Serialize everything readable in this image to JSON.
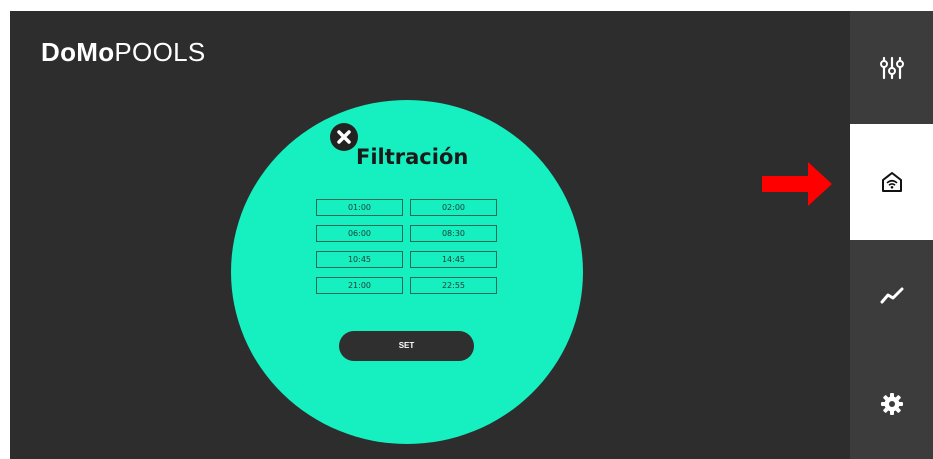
{
  "app": {
    "logo_bold": "DoMo",
    "logo_regular": "POOLS"
  },
  "dialog": {
    "title": "Filtración",
    "schedule": [
      {
        "start": "01:00",
        "end": "02:00"
      },
      {
        "start": "06:00",
        "end": "08:30"
      },
      {
        "start": "10:45",
        "end": "14:45"
      },
      {
        "start": "21:00",
        "end": "22:55"
      }
    ],
    "set_label": "SET",
    "close_icon": "close-icon"
  },
  "sidebar": {
    "items": [
      {
        "name": "sliders-icon",
        "active": false
      },
      {
        "name": "home-wifi-icon",
        "active": true
      },
      {
        "name": "trend-chart-icon",
        "active": false
      },
      {
        "name": "gear-icon",
        "active": false
      }
    ]
  },
  "annotation": {
    "arrow_icon": "red-arrow-right-icon",
    "arrow_color": "#ff0000"
  },
  "colors": {
    "background": "#2d2d2d",
    "circle": "#16efc0",
    "sidebar_dark": "#3c3c3c",
    "sidebar_active": "#ffffff"
  }
}
